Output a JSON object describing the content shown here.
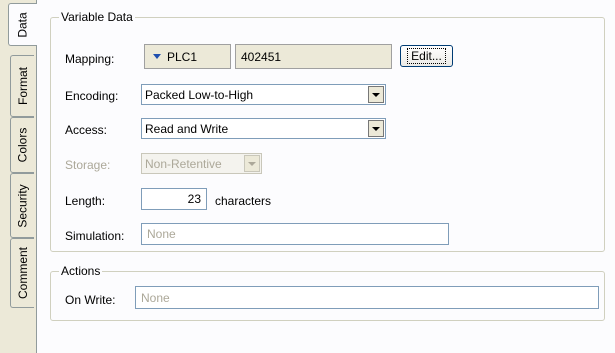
{
  "tabs": [
    {
      "label": "Data",
      "active": true
    },
    {
      "label": "Format",
      "active": false
    },
    {
      "label": "Colors",
      "active": false
    },
    {
      "label": "Security",
      "active": false
    },
    {
      "label": "Comment",
      "active": false
    }
  ],
  "variable_data": {
    "legend": "Variable Data",
    "mapping": {
      "label": "Mapping:",
      "device": "PLC1",
      "address": "402451",
      "edit_button": "Edit..."
    },
    "encoding": {
      "label": "Encoding:",
      "value": "Packed Low-to-High"
    },
    "access": {
      "label": "Access:",
      "value": "Read and Write"
    },
    "storage": {
      "label": "Storage:",
      "value": "Non-Retentive"
    },
    "length": {
      "label": "Length:",
      "value": "23",
      "unit": "characters"
    },
    "simulation": {
      "label": "Simulation:",
      "value": "None"
    }
  },
  "actions": {
    "legend": "Actions",
    "on_write": {
      "label": "On Write:",
      "value": "None"
    }
  }
}
